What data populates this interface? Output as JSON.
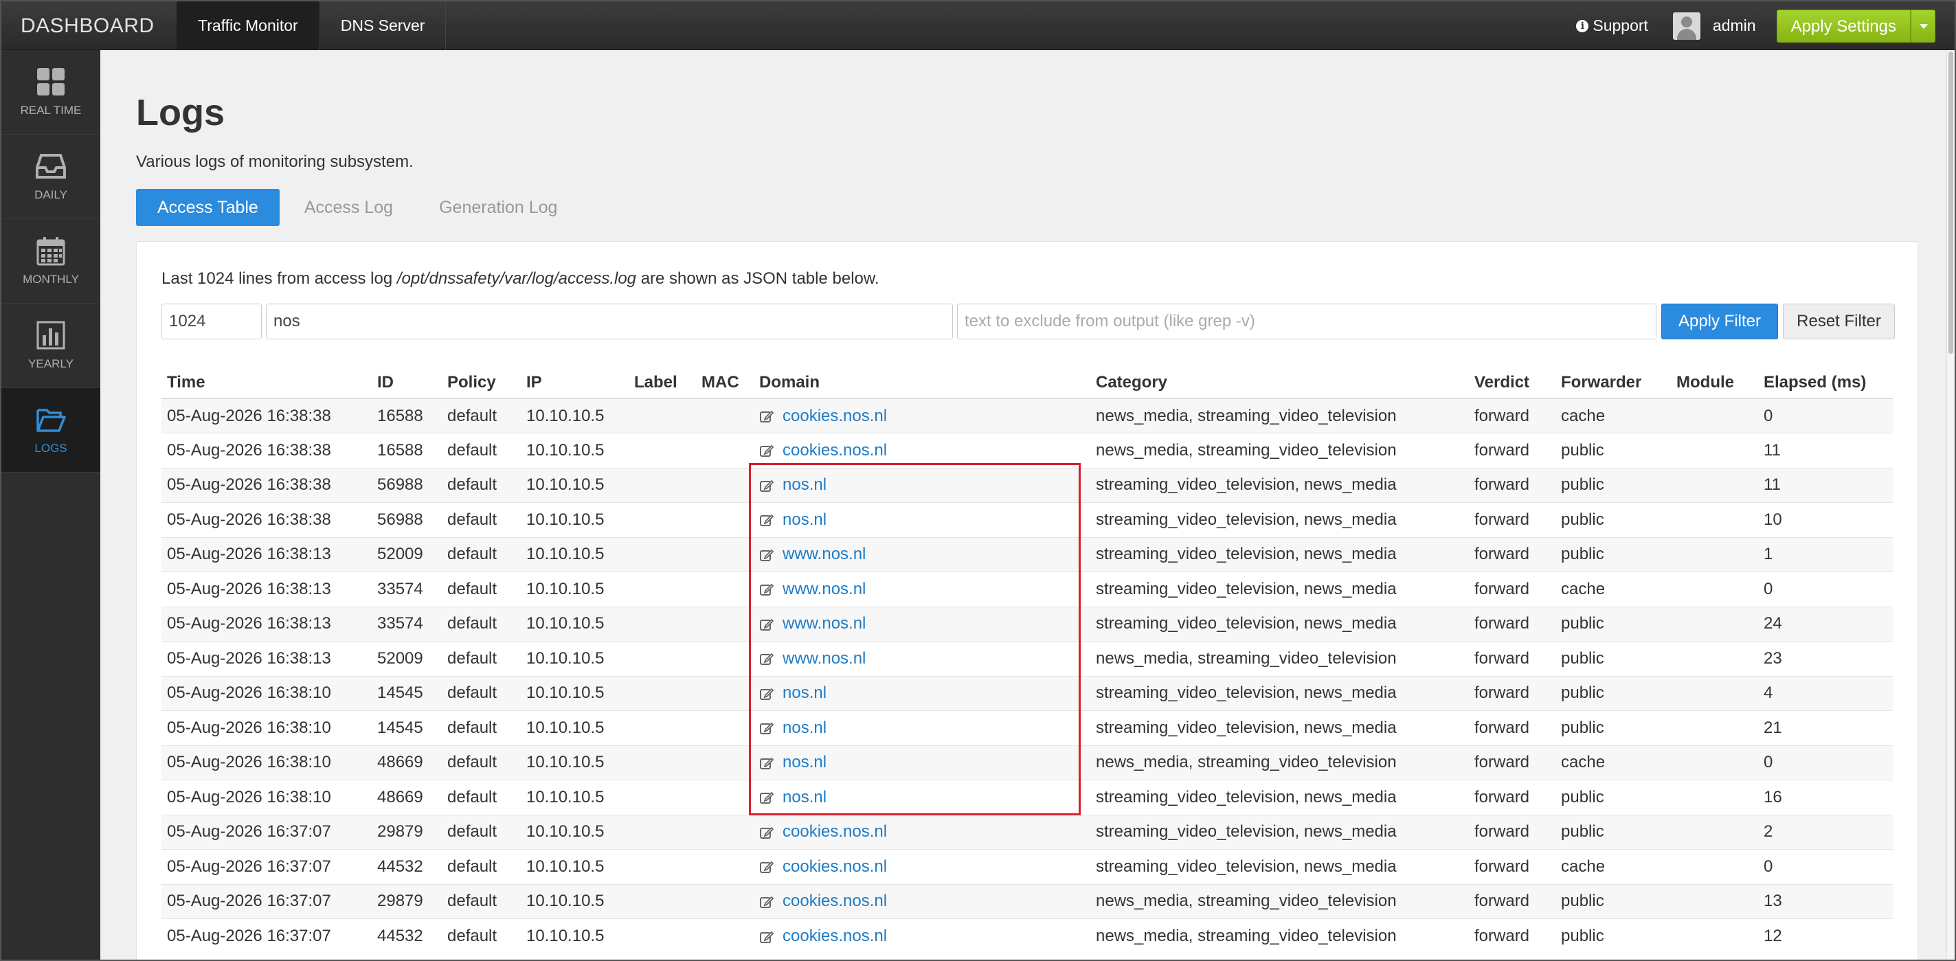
{
  "header": {
    "brand": "DASHBOARD",
    "tabs": [
      "Traffic Monitor",
      "DNS Server"
    ],
    "support": "Support",
    "user": "admin",
    "apply_settings": "Apply Settings"
  },
  "sidebar": {
    "items": [
      {
        "label": "REAL TIME",
        "icon": "grid-icon"
      },
      {
        "label": "DAILY",
        "icon": "inbox-icon"
      },
      {
        "label": "MONTHLY",
        "icon": "calendar-icon"
      },
      {
        "label": "YEARLY",
        "icon": "bar-chart-icon"
      },
      {
        "label": "LOGS",
        "icon": "folder-open-icon",
        "active": true
      }
    ]
  },
  "page": {
    "title": "Logs",
    "subtitle": "Various logs of monitoring subsystem.",
    "tabs": [
      "Access Table",
      "Access Log",
      "Generation Log"
    ],
    "desc_prefix": "Last 1024 lines from access log ",
    "desc_path": "/opt/dnssafety/var/log/access.log",
    "desc_suffix": " are shown as JSON table below."
  },
  "filter": {
    "lines": "1024",
    "include": "nos",
    "exclude_placeholder": "text to exclude from output (like grep -v)",
    "apply_label": "Apply Filter",
    "reset_label": "Reset Filter"
  },
  "table": {
    "columns": [
      "Time",
      "ID",
      "Policy",
      "IP",
      "Label",
      "MAC",
      "Domain",
      "Category",
      "Verdict",
      "Forwarder",
      "Module",
      "Elapsed (ms)"
    ],
    "rows": [
      [
        "05-Aug-2026 16:38:38",
        "16588",
        "default",
        "10.10.10.5",
        "",
        "",
        "cookies.nos.nl",
        "news_media, streaming_video_television",
        "forward",
        "cache",
        "",
        "0"
      ],
      [
        "05-Aug-2026 16:38:38",
        "16588",
        "default",
        "10.10.10.5",
        "",
        "",
        "cookies.nos.nl",
        "news_media, streaming_video_television",
        "forward",
        "public",
        "",
        "11"
      ],
      [
        "05-Aug-2026 16:38:38",
        "56988",
        "default",
        "10.10.10.5",
        "",
        "",
        "nos.nl",
        "streaming_video_television, news_media",
        "forward",
        "public",
        "",
        "11"
      ],
      [
        "05-Aug-2026 16:38:38",
        "56988",
        "default",
        "10.10.10.5",
        "",
        "",
        "nos.nl",
        "streaming_video_television, news_media",
        "forward",
        "public",
        "",
        "10"
      ],
      [
        "05-Aug-2026 16:38:13",
        "52009",
        "default",
        "10.10.10.5",
        "",
        "",
        "www.nos.nl",
        "streaming_video_television, news_media",
        "forward",
        "public",
        "",
        "1"
      ],
      [
        "05-Aug-2026 16:38:13",
        "33574",
        "default",
        "10.10.10.5",
        "",
        "",
        "www.nos.nl",
        "streaming_video_television, news_media",
        "forward",
        "cache",
        "",
        "0"
      ],
      [
        "05-Aug-2026 16:38:13",
        "33574",
        "default",
        "10.10.10.5",
        "",
        "",
        "www.nos.nl",
        "streaming_video_television, news_media",
        "forward",
        "public",
        "",
        "24"
      ],
      [
        "05-Aug-2026 16:38:13",
        "52009",
        "default",
        "10.10.10.5",
        "",
        "",
        "www.nos.nl",
        "news_media, streaming_video_television",
        "forward",
        "public",
        "",
        "23"
      ],
      [
        "05-Aug-2026 16:38:10",
        "14545",
        "default",
        "10.10.10.5",
        "",
        "",
        "nos.nl",
        "streaming_video_television, news_media",
        "forward",
        "public",
        "",
        "4"
      ],
      [
        "05-Aug-2026 16:38:10",
        "14545",
        "default",
        "10.10.10.5",
        "",
        "",
        "nos.nl",
        "streaming_video_television, news_media",
        "forward",
        "public",
        "",
        "21"
      ],
      [
        "05-Aug-2026 16:38:10",
        "48669",
        "default",
        "10.10.10.5",
        "",
        "",
        "nos.nl",
        "news_media, streaming_video_television",
        "forward",
        "cache",
        "",
        "0"
      ],
      [
        "05-Aug-2026 16:38:10",
        "48669",
        "default",
        "10.10.10.5",
        "",
        "",
        "nos.nl",
        "streaming_video_television, news_media",
        "forward",
        "public",
        "",
        "16"
      ],
      [
        "05-Aug-2026 16:37:07",
        "29879",
        "default",
        "10.10.10.5",
        "",
        "",
        "cookies.nos.nl",
        "streaming_video_television, news_media",
        "forward",
        "public",
        "",
        "2"
      ],
      [
        "05-Aug-2026 16:37:07",
        "44532",
        "default",
        "10.10.10.5",
        "",
        "",
        "cookies.nos.nl",
        "streaming_video_television, news_media",
        "forward",
        "cache",
        "",
        "0"
      ],
      [
        "05-Aug-2026 16:37:07",
        "29879",
        "default",
        "10.10.10.5",
        "",
        "",
        "cookies.nos.nl",
        "news_media, streaming_video_television",
        "forward",
        "public",
        "",
        "13"
      ],
      [
        "05-Aug-2026 16:37:07",
        "44532",
        "default",
        "10.10.10.5",
        "",
        "",
        "cookies.nos.nl",
        "news_media, streaming_video_television",
        "forward",
        "public",
        "",
        "12"
      ]
    ]
  },
  "colors": {
    "accent": "#2b8bde",
    "apply_settings": "#95c41f",
    "highlight": "#d6202c",
    "link": "#1e7bc6"
  }
}
